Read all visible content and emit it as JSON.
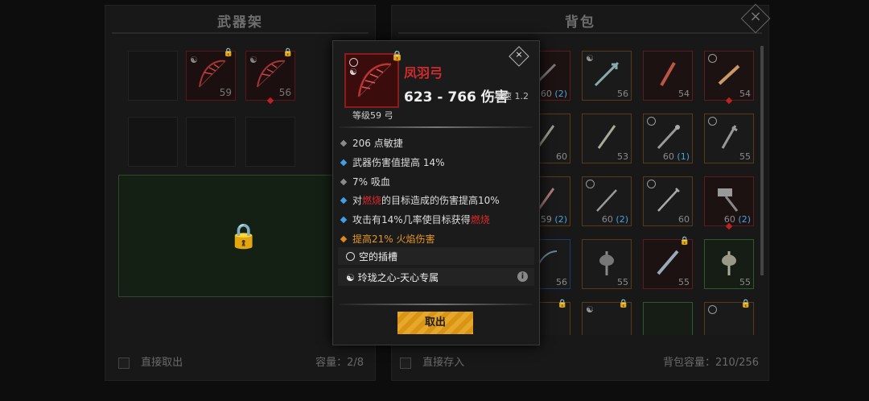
{
  "colors": {
    "rarity_red": "#8a1c1c",
    "rarity_orange": "#5b3a13",
    "rarity_blue": "#1c3b6a",
    "rarity_green": "#2e5a2b",
    "accent_gold": "#e6a82a",
    "fire": "#e02828"
  },
  "rack": {
    "title": "武器架",
    "items": [
      {
        "level": "59"
      },
      {
        "level": "56"
      }
    ],
    "footer_label": "直接取出",
    "capacity": "容量：2/8"
  },
  "bag": {
    "title": "背包",
    "close_icon": "close-icon",
    "footer_label": "直接存入",
    "capacity": "背包容量：210/256",
    "rows": [
      [
        {
          "lvl": "60",
          "sub": "(2)"
        },
        {
          "lvl": "56",
          "sub": ""
        },
        {
          "lvl": "54",
          "sub": ""
        },
        {
          "lvl": "54",
          "sub": ""
        }
      ],
      [
        {
          "lvl": "60",
          "sub": ""
        },
        {
          "lvl": "53",
          "sub": ""
        },
        {
          "lvl": "60",
          "sub": "(1)"
        },
        {
          "lvl": "55",
          "sub": ""
        }
      ],
      [
        {
          "lvl": "59",
          "sub": "(2)"
        },
        {
          "lvl": "60",
          "sub": "(2)"
        },
        {
          "lvl": "60",
          "sub": ""
        },
        {
          "lvl": "60",
          "sub": "(2)"
        }
      ],
      [
        {
          "lvl": "56",
          "sub": ""
        },
        {
          "lvl": "55",
          "sub": ""
        },
        {
          "lvl": "55",
          "sub": ""
        },
        {
          "lvl": "55",
          "sub": ""
        }
      ]
    ]
  },
  "tooltip": {
    "name": "凤羽弓",
    "damage": "623 - 766 伤害",
    "speed": "攻速 1.2",
    "grade": "等级59 弓",
    "attrs": {
      "a1": "206 点敏捷",
      "a2": "武器伤害值提高 14%",
      "a3": "7% 吸血",
      "a4_pre": "对",
      "a4_fire": "燃烧",
      "a4_post": "的目标造成的伤害提高10%",
      "a5_pre": "攻击有14%几率使目标获得",
      "a5_fire": "燃烧",
      "a6": "提高21% 火焰伤害"
    },
    "socket": "空的插槽",
    "exclusive": "玲珑之心-天心专属",
    "info_glyph": "i",
    "cancel": "取出"
  }
}
